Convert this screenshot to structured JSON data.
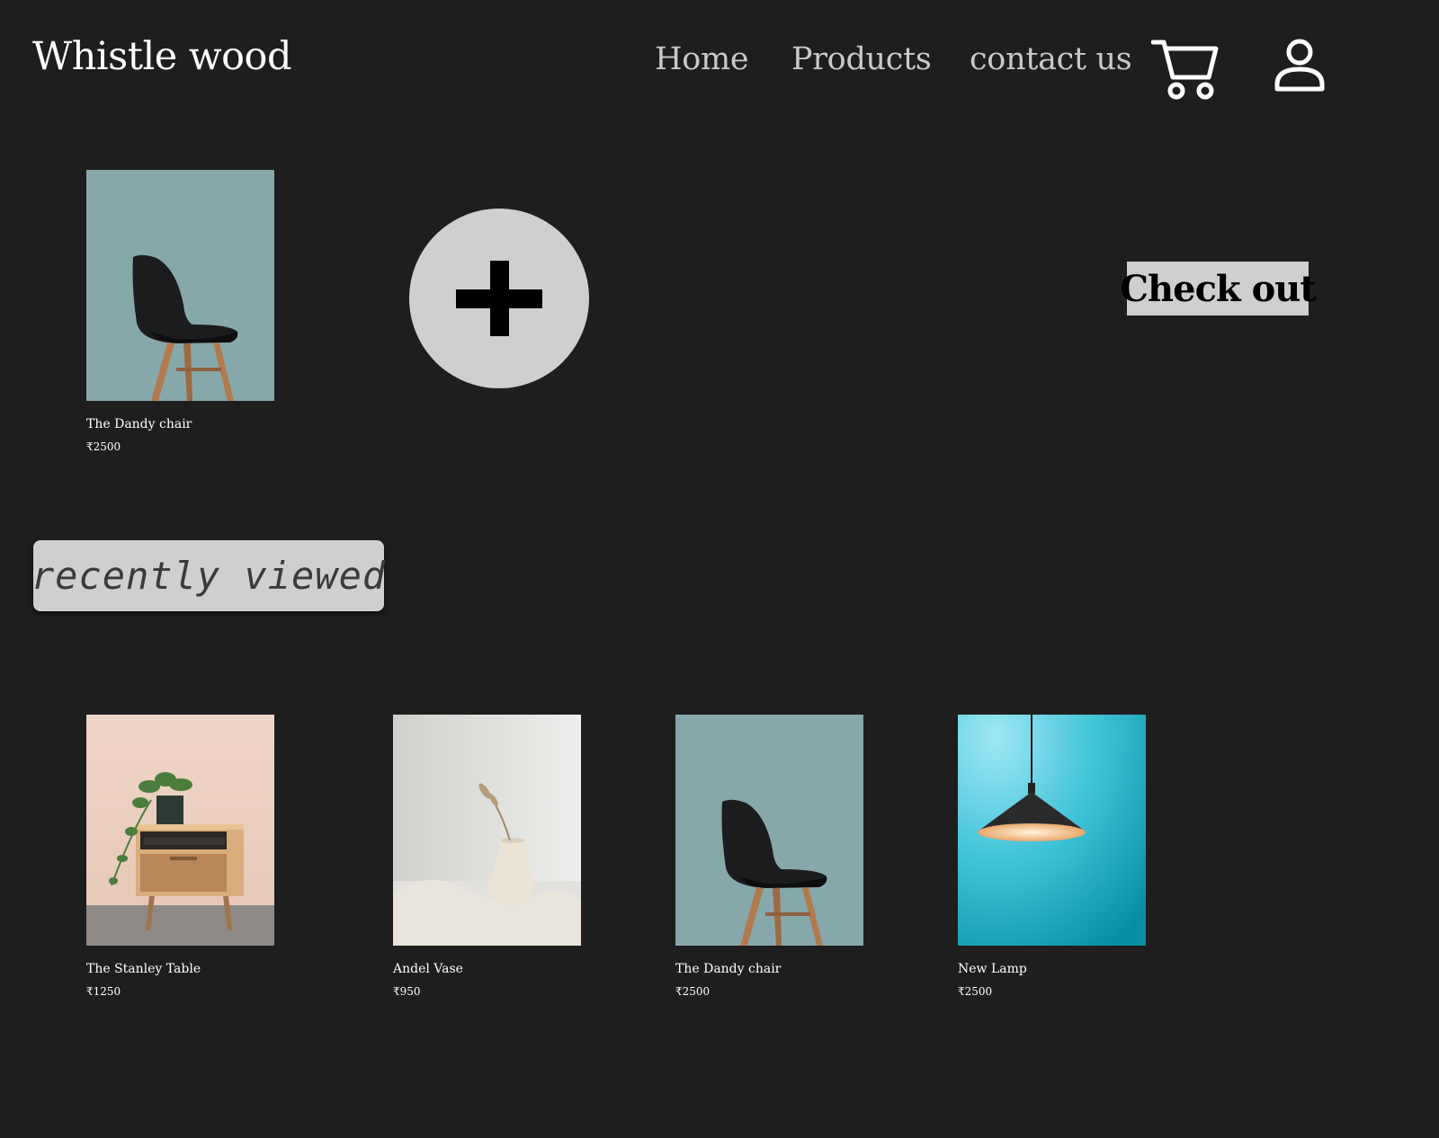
{
  "header": {
    "brand": "Whistle wood",
    "nav": {
      "home": "Home",
      "products": "Products",
      "contact": "contact us"
    },
    "icons": [
      "cart-icon",
      "user-icon"
    ]
  },
  "cart": {
    "item": {
      "name": "The Dandy chair",
      "price": "₹2500",
      "image": "chair-photo"
    },
    "add_icon": "plus-icon",
    "checkout_label": "Check out"
  },
  "recently_viewed": {
    "title": "recently viewed",
    "items": [
      {
        "name": "The Stanley Table",
        "price": "₹1250",
        "image": "side-table-photo"
      },
      {
        "name": "Andel Vase",
        "price": "₹950",
        "image": "vase-photo"
      },
      {
        "name": "The Dandy chair",
        "price": "₹2500",
        "image": "chair-photo"
      },
      {
        "name": "New Lamp",
        "price": "₹2500",
        "image": "pendant-lamp-photo"
      }
    ]
  },
  "colors": {
    "background": "#1e1e1e",
    "nav_text": "#c9c9c9",
    "button_bg": "#cfcfcf",
    "chair_bg": "#87a8ab",
    "table_bg": "#ecd2c4",
    "vase_bg": "#e4e4e2",
    "lamp_bg": "#1fb0c4"
  }
}
